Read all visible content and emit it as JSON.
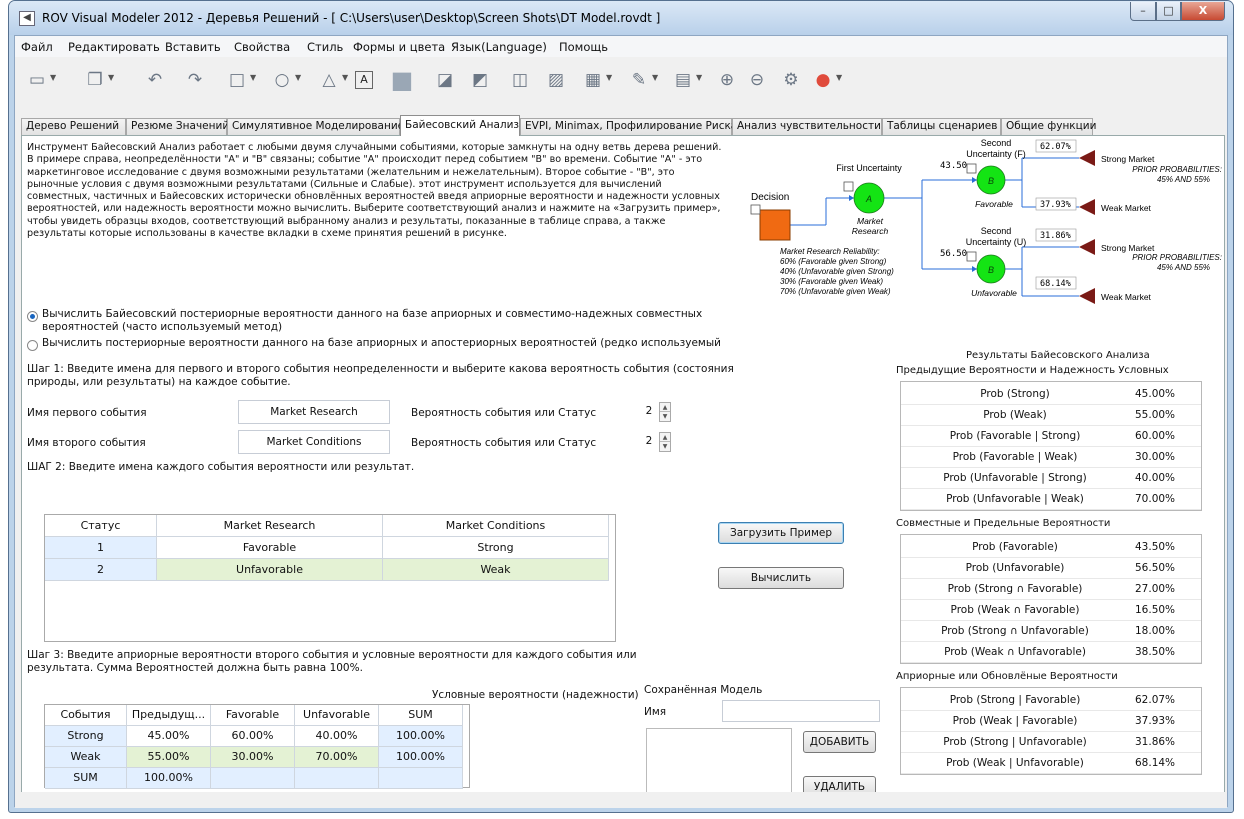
{
  "window": {
    "title": "ROV Visual Modeler 2012 - Деревья Решений - [ C:\\Users\\user\\Desktop\\Screen Shots\\DT Model.rovdt ]",
    "min_glyph": "–",
    "max_glyph": "□",
    "close_glyph": "X"
  },
  "menu": [
    "Файл",
    "Редактировать",
    "Вставить",
    "Свойства",
    "Стиль",
    "Формы и цвета",
    "Язык(Language)",
    "Помощь"
  ],
  "toolbar": {
    "tools": [
      {
        "name": "new-file-icon",
        "glyph": "▭"
      },
      {
        "name": "copy-icon",
        "glyph": "❐"
      },
      {
        "name": "undo-icon",
        "glyph": "↶"
      },
      {
        "name": "redo-icon",
        "glyph": "↷"
      },
      {
        "name": "rectangle-icon",
        "glyph": "□"
      },
      {
        "name": "ellipse-icon",
        "glyph": "○"
      },
      {
        "name": "triangle-icon",
        "glyph": "△"
      },
      {
        "name": "text-box-icon",
        "glyph": "A"
      },
      {
        "name": "fill-icon",
        "glyph": "■"
      },
      {
        "name": "terminal-shape-icon",
        "glyph": "◪"
      },
      {
        "name": "chance-shape-icon",
        "glyph": "◩"
      },
      {
        "name": "decision-shape-icon",
        "glyph": "◫"
      },
      {
        "name": "chart-icon",
        "glyph": "▨"
      },
      {
        "name": "calculator-icon",
        "glyph": "▦"
      },
      {
        "name": "pencil-icon",
        "glyph": "✎"
      },
      {
        "name": "layout-icon",
        "glyph": "▤"
      },
      {
        "name": "zoom-in-icon",
        "glyph": "⊕"
      },
      {
        "name": "zoom-out-icon",
        "glyph": "⊖"
      },
      {
        "name": "settings-icon",
        "glyph": "⚙"
      },
      {
        "name": "color-palette-icon",
        "glyph": "●"
      }
    ],
    "accent_color": "#e04b3c"
  },
  "tabs": [
    "Дерево Решений",
    "Резюме Значений",
    "Симулятивное Моделирование",
    "Байесовский Анализ",
    "EVPI, Minimax, Профилирование Риска",
    "Анализ чувствительности",
    "Таблицы сценариев",
    "Общие функции"
  ],
  "active_tab": "Байесовский Анализ",
  "intro_text": "Инструмент Байесовский Анализ работает с любыми двумя случайными событиями, которые замкнуты на одну ветвь дерева решений. В примере справа, неопределённости \"А\" и \"В\" связаны; событие \"А\" происходит перед событием \"В\" во времени. Событие \"А\" - это маркетинговое исследование с двумя возможными результатами (желательним и нежелательным). Второе событие - \"В\", это рыночные условия с двумя возможными результатами (Сильные и Слабые). этот инструмент используется для вычислений совместных, частичных и Байесовских исторически обновлённых вероятностей введя априорные вероятности и надежности условных вероятностей, или надежность вероятности можно вычислить. Выберите соответствующий анализ и нажмите на «Загрузить пример», чтобы увидеть образцы входов, соответствующий выбранному анализ и результаты, показанные в таблице справа, а также результаты которые использованы в качестве вкладки в схеме принятия решений в рисунке.",
  "diagram": {
    "decision": "Decision",
    "first_uncertainty": "First Uncertainty",
    "node_a": "A",
    "node_b": "B",
    "market_research": [
      "Market",
      "Research"
    ],
    "second_f": [
      "Second",
      "Uncertainty (F)"
    ],
    "second_u": [
      "Second",
      "Uncertainty (U)"
    ],
    "favorable": "Favorable",
    "unfavorable": "Unfavorable",
    "val_f": "43.50",
    "val_u": "56.50",
    "p_sf": "62.07%",
    "p_wf": "37.93%",
    "p_su": "31.86%",
    "p_wu": "68.14%",
    "strong_market": "Strong Market",
    "weak_market": "Weak Market",
    "prior_title": "PRIOR PROBABILITIES:",
    "prior_vals": "45% AND 55%",
    "reliability_title": "Market Research Reliability:",
    "reliability": [
      "60% (Favorable given Strong)",
      "40% (Unfavorable given Strong)",
      "30% (Favorable given Weak)",
      "70% (Unfavorable given Weak)"
    ],
    "decision_color": "#f06a12",
    "chance_color": "#14e414",
    "terminal_color": "#7a1a16",
    "line_color": "#2a6ed8"
  },
  "options": {
    "opt1": "Вычислить Байесовский постериорные вероятности данного на базе априорных и совместимо-надежных совместных вероятностей (часто используемый метод)",
    "opt2": "Вычислить постериорные вероятности данного на базе априорных и апостериорных вероятностей (редко используемый"
  },
  "step1": {
    "text": "Шаг 1: Введите имена для первого и второго события неопределенности и выберите какова вероятность события (состояния природы, или результаты) на каждое событие.",
    "first_label": "Имя первого события",
    "first_value": "Market Research",
    "second_label": "Имя второго события",
    "second_value": "Market Conditions",
    "prob_label": "Вероятность события или Статус",
    "count1": "2",
    "count2": "2",
    "spin_up": "▲",
    "spin_down": "▼"
  },
  "step2": {
    "text": "ШАГ 2: Введите имена каждого события вероятности или результат.",
    "headers": [
      "Статус",
      "Market Research",
      "Market Conditions"
    ],
    "rows": [
      [
        "1",
        "Favorable",
        "Strong"
      ],
      [
        "2",
        "Unfavorable",
        "Weak"
      ]
    ]
  },
  "buttons": {
    "load": "Загрузить Пример",
    "compute": "Вычислить",
    "add": "ДОБАВИТЬ",
    "delete": "УДАЛИТЬ"
  },
  "step3": {
    "text": "Шаг 3: Введите априорные вероятности второго события и условные вероятности для каждого события или результата. Сумма Вероятностей должна быть равна 100%.",
    "caption": "Условные вероятности (надежности)",
    "headers": [
      "События",
      "Предыдущ...",
      "Favorable",
      "Unfavorable",
      "SUM"
    ],
    "rows": [
      [
        "Strong",
        "45.00%",
        "60.00%",
        "40.00%",
        "100.00%"
      ],
      [
        "Weak",
        "55.00%",
        "30.00%",
        "70.00%",
        "100.00%"
      ],
      [
        "SUM",
        "100.00%",
        "",
        "",
        ""
      ]
    ]
  },
  "saved_model": {
    "title": "Сохранённая Модель",
    "name_label": "Имя",
    "name_value": ""
  },
  "results": {
    "title": "Результаты Байесовского Анализа",
    "prior_title": "Предыдущие Вероятности и Надежность Условных",
    "prior": [
      [
        "Prob (Strong)",
        "45.00%"
      ],
      [
        "Prob (Weak)",
        "55.00%"
      ],
      [
        "Prob (Favorable | Strong)",
        "60.00%"
      ],
      [
        "Prob (Favorable | Weak)",
        "30.00%"
      ],
      [
        "Prob (Unfavorable | Strong)",
        "40.00%"
      ],
      [
        "Prob (Unfavorable | Weak)",
        "70.00%"
      ]
    ],
    "joint_title": "Совместные и Предельные Вероятности",
    "joint": [
      [
        "Prob (Favorable)",
        "43.50%"
      ],
      [
        "Prob (Unfavorable)",
        "56.50%"
      ],
      [
        "Prob (Strong ∩ Favorable)",
        "27.00%"
      ],
      [
        "Prob (Weak ∩ Favorable)",
        "16.50%"
      ],
      [
        "Prob (Strong ∩ Unfavorable)",
        "18.00%"
      ],
      [
        "Prob (Weak ∩ Unfavorable)",
        "38.50%"
      ]
    ],
    "posterior_title": "Априорные или Обновлёные Вероятности",
    "posterior": [
      [
        "Prob (Strong | Favorable)",
        "62.07%"
      ],
      [
        "Prob (Weak | Favorable)",
        "37.93%"
      ],
      [
        "Prob (Strong | Unfavorable)",
        "31.86%"
      ],
      [
        "Prob (Weak | Unfavorable)",
        "68.14%"
      ]
    ]
  }
}
